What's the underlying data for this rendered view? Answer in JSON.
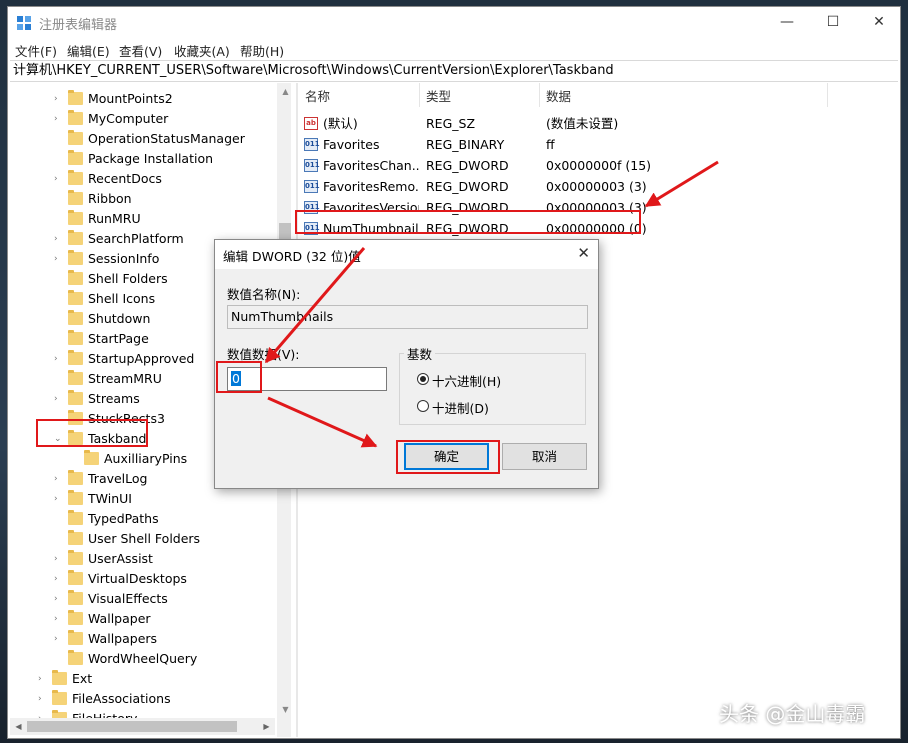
{
  "window": {
    "title": "注册表编辑器",
    "controls": [
      "—",
      "☐",
      "✕"
    ],
    "menu": [
      "文件(F)",
      "编辑(E)",
      "查看(V)",
      "收藏夹(A)",
      "帮助(H)"
    ],
    "address": "计算机\\HKEY_CURRENT_USER\\Software\\Microsoft\\Windows\\CurrentVersion\\Explorer\\Taskband"
  },
  "tree": {
    "items": [
      {
        "label": "MountPoints2",
        "level": 1,
        "expander": "›"
      },
      {
        "label": "MyComputer",
        "level": 1,
        "expander": "›"
      },
      {
        "label": "OperationStatusManager",
        "level": 1,
        "expander": ""
      },
      {
        "label": "Package Installation",
        "level": 1,
        "expander": ""
      },
      {
        "label": "RecentDocs",
        "level": 1,
        "expander": "›"
      },
      {
        "label": "Ribbon",
        "level": 1,
        "expander": ""
      },
      {
        "label": "RunMRU",
        "level": 1,
        "expander": ""
      },
      {
        "label": "SearchPlatform",
        "level": 1,
        "expander": "›"
      },
      {
        "label": "SessionInfo",
        "level": 1,
        "expander": "›"
      },
      {
        "label": "Shell Folders",
        "level": 1,
        "expander": ""
      },
      {
        "label": "Shell Icons",
        "level": 1,
        "expander": ""
      },
      {
        "label": "Shutdown",
        "level": 1,
        "expander": ""
      },
      {
        "label": "StartPage",
        "level": 1,
        "expander": ""
      },
      {
        "label": "StartupApproved",
        "level": 1,
        "expander": "›"
      },
      {
        "label": "StreamMRU",
        "level": 1,
        "expander": ""
      },
      {
        "label": "Streams",
        "level": 1,
        "expander": "›"
      },
      {
        "label": "StuckRects3",
        "level": 1,
        "expander": ""
      },
      {
        "label": "Taskband",
        "level": 1,
        "expander": "⌄"
      },
      {
        "label": "AuxilliaryPins",
        "level": 2,
        "expander": ""
      },
      {
        "label": "TravelLog",
        "level": 1,
        "expander": "›"
      },
      {
        "label": "TWinUI",
        "level": 1,
        "expander": "›"
      },
      {
        "label": "TypedPaths",
        "level": 1,
        "expander": ""
      },
      {
        "label": "User Shell Folders",
        "level": 1,
        "expander": ""
      },
      {
        "label": "UserAssist",
        "level": 1,
        "expander": "›"
      },
      {
        "label": "VirtualDesktops",
        "level": 1,
        "expander": "›"
      },
      {
        "label": "VisualEffects",
        "level": 1,
        "expander": "›"
      },
      {
        "label": "Wallpaper",
        "level": 1,
        "expander": "›"
      },
      {
        "label": "Wallpapers",
        "level": 1,
        "expander": "›"
      },
      {
        "label": "WordWheelQuery",
        "level": 1,
        "expander": ""
      },
      {
        "label": "Ext",
        "level": 0,
        "expander": "›"
      },
      {
        "label": "FileAssociations",
        "level": 0,
        "expander": "›"
      },
      {
        "label": "FileHistory",
        "level": 0,
        "expander": "›"
      }
    ]
  },
  "list": {
    "headers": [
      "名称",
      "类型",
      "数据"
    ],
    "rows": [
      {
        "icon": "ab",
        "name": "(默认)",
        "type": "REG_SZ",
        "data": "(数值未设置)"
      },
      {
        "icon": "011",
        "name": "Favorites",
        "type": "REG_BINARY",
        "data": "ff"
      },
      {
        "icon": "011",
        "name": "FavoritesChan...",
        "type": "REG_DWORD",
        "data": "0x0000000f (15)"
      },
      {
        "icon": "011",
        "name": "FavoritesRemo...",
        "type": "REG_DWORD",
        "data": "0x00000003 (3)"
      },
      {
        "icon": "011",
        "name": "FavoritesVersion",
        "type": "REG_DWORD",
        "data": "0x00000003 (3)"
      },
      {
        "icon": "011",
        "name": "NumThumbnails",
        "type": "REG_DWORD",
        "data": "0x00000000 (0)"
      }
    ]
  },
  "dialog": {
    "title": "编辑 DWORD (32 位)值",
    "close": "✕",
    "name_label": "数值名称(N):",
    "name_value": "NumThumbnails",
    "data_label": "数值数据(V):",
    "data_value": "0",
    "base_label": "基数",
    "hex_label": "十六进制(H)",
    "dec_label": "十进制(D)",
    "ok": "确定",
    "cancel": "取消"
  },
  "watermark": "头条 @金山毒霸",
  "colors": {
    "highlight": "#e0181a",
    "accent": "#0078d7",
    "folder": "#f5d378"
  }
}
